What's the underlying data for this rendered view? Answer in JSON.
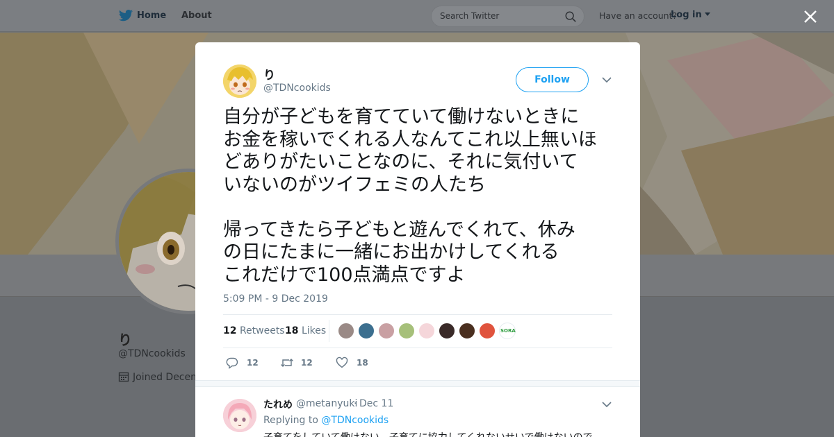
{
  "topbar": {
    "home_label": "Home",
    "about_label": "About",
    "search_placeholder": "Search Twitter",
    "account_prompt": "Have an account?",
    "login_label": "Log in"
  },
  "profile": {
    "name": "り",
    "handle": "@TDNcookids",
    "joined": "Joined Decem"
  },
  "tweet": {
    "author_name": "り",
    "author_handle": "@TDNcookids",
    "follow_label": "Follow",
    "text": "自分が子どもを育てていて働けないときに\nお金を稼いでくれる人なんてこれ以上無いほ\nどありがたいことなのに、それに気付いて\nいないのがツイフェミの人たち\n\n帰ってきたら子どもと遊んでくれて、休み\nの日にたまに一緒にお出かけしてくれる\nこれだけで100点満点ですよ",
    "timestamp": "5:09 PM - 9 Dec 2019",
    "retweets_count": "12",
    "retweets_label": "Retweets",
    "likes_count": "18",
    "likes_label": "Likes",
    "liker_colors": [
      "#9a8a86",
      "#3c6f8f",
      "#c9a0a3",
      "#a6c07a",
      "#f5d6da",
      "#3a2a28",
      "#4a2f1f",
      "#e0533d",
      "#2e9c3f"
    ],
    "liker_last_label": "SORA",
    "actions": {
      "reply_count": "12",
      "retweet_count": "12",
      "like_count": "18"
    }
  },
  "reply": {
    "name": "たれめ",
    "handle": "@metanyuki",
    "separator": "·",
    "date": "Dec 11",
    "replying_prefix": "Replying to",
    "replying_to": "@TDNcookids",
    "text": "子育てをしていて働けない、子育てに協力してくれないせいで働けないので"
  },
  "colors": {
    "accent": "#1da1f2",
    "text_primary": "#14171a",
    "text_secondary": "#657786"
  }
}
